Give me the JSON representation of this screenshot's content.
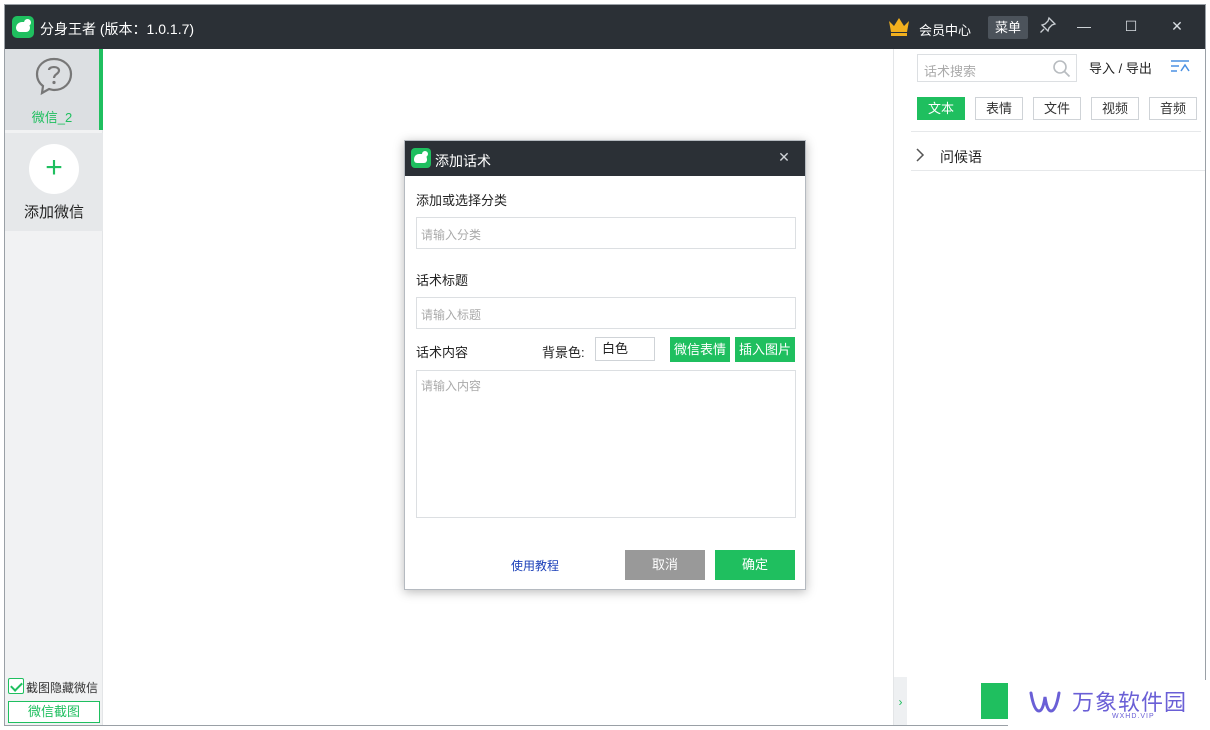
{
  "window": {
    "title": "分身王者 (版本：1.0.1.7)",
    "vip_label": "会员中心",
    "menu_label": "菜单",
    "minimize_glyph": "—",
    "maximize_glyph": "☐",
    "close_glyph": "✕"
  },
  "sidebar": {
    "accounts": [
      {
        "name": "微信_2",
        "avatar": "question-chat-icon",
        "selected": true
      }
    ],
    "add_icon": "+",
    "add_label": "添加微信",
    "hide_checkbox": {
      "label": "截图隐藏微信",
      "checked": true
    },
    "screenshot_button": "微信截图"
  },
  "right_panel": {
    "search_placeholder": "话术搜索",
    "import_export": "导入 / 导出",
    "tabs": [
      {
        "label": "文本",
        "active": true
      },
      {
        "label": "表情",
        "active": false
      },
      {
        "label": "文件",
        "active": false
      },
      {
        "label": "视频",
        "active": false
      },
      {
        "label": "音频",
        "active": false
      }
    ],
    "groups": [
      {
        "label": "问候语"
      }
    ],
    "collapse_glyph": "›"
  },
  "dialog": {
    "title": "添加话术",
    "close_glyph": "✕",
    "category_label": "添加或选择分类",
    "category_placeholder": "请输入分类",
    "title_label": "话术标题",
    "title_placeholder": "请输入标题",
    "content_label": "话术内容",
    "bg_color_label": "背景色:",
    "bg_color_value": "白色",
    "emoji_button": "微信表情",
    "insert_image_button": "插入图片",
    "content_placeholder": "请输入内容",
    "tutorial_link": "使用教程",
    "cancel_button": "取消",
    "ok_button": "确定"
  },
  "watermark": {
    "text": "万象软件园",
    "subtext": "WXHD.VIP"
  },
  "colors": {
    "accent": "#1fbf5f",
    "titlebar": "#2b3036",
    "link": "#1a3fb8",
    "watermark": "#6a5fd6"
  }
}
